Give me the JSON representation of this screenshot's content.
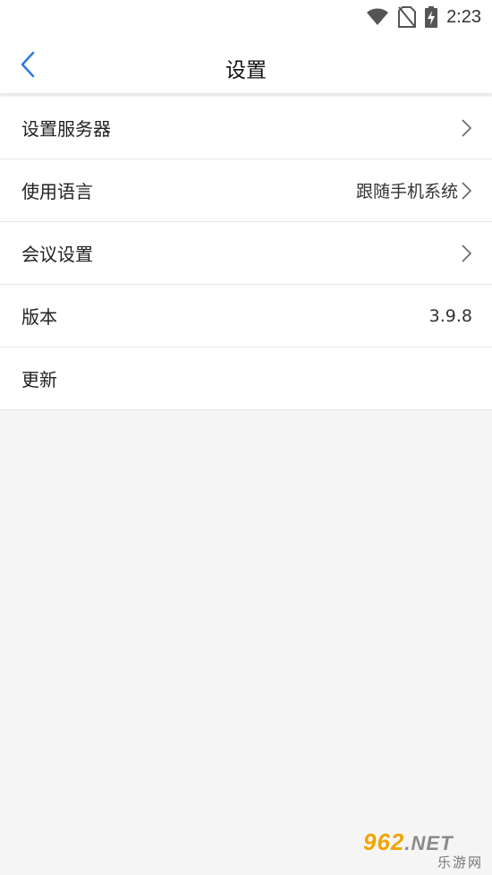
{
  "status_bar": {
    "time": "2:23",
    "icons": [
      "wifi-icon",
      "no-sim-icon",
      "battery-charging-icon"
    ]
  },
  "header": {
    "title": "设置",
    "back_icon": "chevron-left-icon",
    "accent_color": "#2f7ddb"
  },
  "settings": {
    "items": [
      {
        "label": "设置服务器",
        "value": "",
        "has_chevron": true
      },
      {
        "label": "使用语言",
        "value": "跟随手机系统",
        "has_chevron": true
      },
      {
        "label": "会议设置",
        "value": "",
        "has_chevron": true
      },
      {
        "label": "版本",
        "value": "3.9.8",
        "has_chevron": false
      },
      {
        "label": "更新",
        "value": "",
        "has_chevron": false
      }
    ]
  },
  "watermark": {
    "brand": "962",
    "suffix": ".NET",
    "subtitle": "乐游网"
  }
}
